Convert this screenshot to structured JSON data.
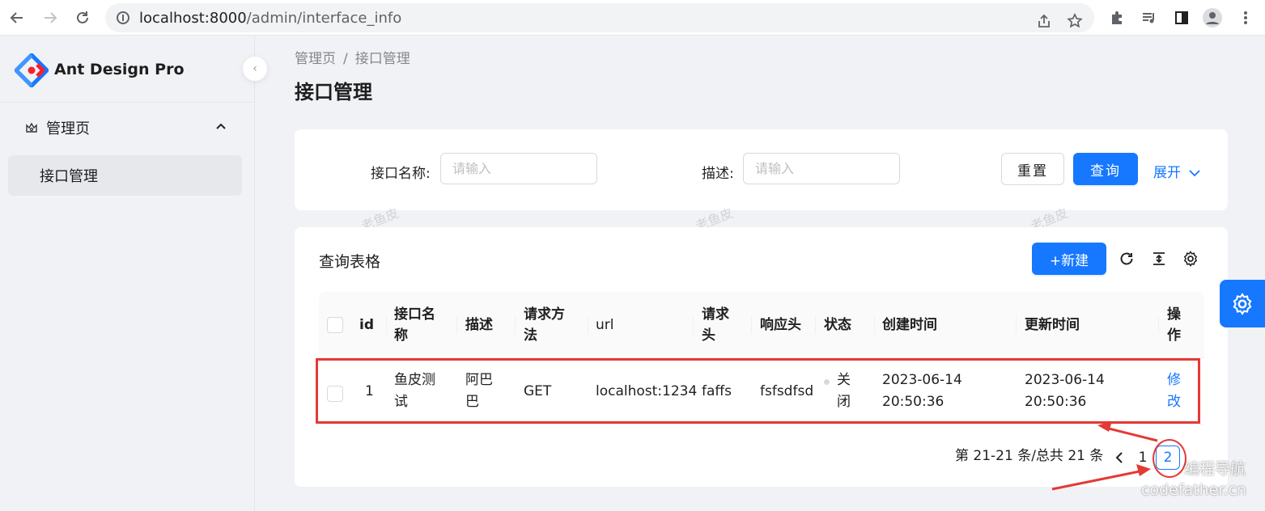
{
  "browser": {
    "url_host": "localhost:8000",
    "url_path": "/admin/interface_info"
  },
  "sidebar": {
    "brand": "Ant Design Pro",
    "group": {
      "label": "管理页"
    },
    "items": [
      {
        "label": "接口管理"
      }
    ]
  },
  "breadcrumb": {
    "root": "管理页",
    "separator": "/",
    "current": "接口管理"
  },
  "page": {
    "title": "接口管理"
  },
  "search": {
    "name_label": "接口名称:",
    "name_placeholder": "请输入",
    "desc_label": "描述:",
    "desc_placeholder": "请输入",
    "reset_label": "重置",
    "query_label": "查询",
    "expand_label": "展开"
  },
  "watermark": "老鱼皮",
  "table": {
    "title": "查询表格",
    "new_label": "+新建",
    "columns": [
      {
        "l1": "id",
        "l2": ""
      },
      {
        "l1": "接口名",
        "l2": "称"
      },
      {
        "l1": "描述",
        "l2": ""
      },
      {
        "l1": "请求方",
        "l2": "法"
      },
      {
        "l1": "url",
        "l2": ""
      },
      {
        "l1": "请求",
        "l2": "头"
      },
      {
        "l1": "响应头",
        "l2": ""
      },
      {
        "l1": "状态",
        "l2": ""
      },
      {
        "l1": "创建时间",
        "l2": ""
      },
      {
        "l1": "更新时间",
        "l2": ""
      },
      {
        "l1": "操",
        "l2": "作"
      }
    ],
    "rows": [
      {
        "id": "1",
        "name_1": "鱼皮测",
        "name_2": "试",
        "desc_1": "阿巴",
        "desc_2": "巴",
        "method": "GET",
        "url": "localhost:1234",
        "request_header": "faffs",
        "response_header": "fsfsdfsd",
        "status_1": "关",
        "status_2": "闭",
        "created_date": "2023-06-14",
        "created_time": "20:50:36",
        "updated_date": "2023-06-14",
        "updated_time": "20:50:36",
        "action_1": "修",
        "action_2": "改"
      }
    ]
  },
  "pagination": {
    "summary": "第 21-21 条/总共 21 条",
    "pages": [
      "1",
      "2"
    ],
    "current": "2"
  },
  "corner_watermark": {
    "line1": "编程导航",
    "line2": "codefather.cn"
  },
  "colors": {
    "primary": "#1677ff",
    "annotation_red": "#e53935"
  }
}
